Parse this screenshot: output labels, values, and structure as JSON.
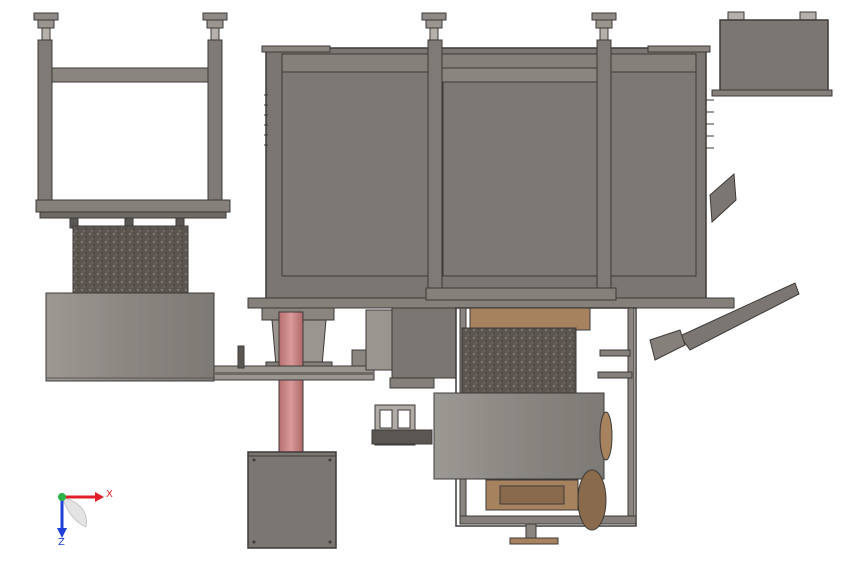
{
  "triad": {
    "x_label": "X",
    "z_label": "Z",
    "x_color": "#e0202a",
    "z_color": "#1f3fd6",
    "y_color": "#2bb34a"
  },
  "colors": {
    "frame": "#7f7a75",
    "frame_dark": "#3c3a38",
    "panel": "#7b7671",
    "drum": "#8f8b86",
    "stone": "#5c5650",
    "column": "#c98383",
    "wood": "#a6825f",
    "background": "#ffffff"
  }
}
